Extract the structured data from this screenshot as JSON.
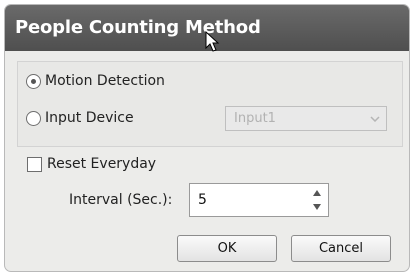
{
  "window": {
    "title": "People Counting Method"
  },
  "method_group": {
    "options": [
      {
        "label": "Motion Detection",
        "checked": true
      },
      {
        "label": "Input Device",
        "checked": false
      }
    ],
    "input_device_select": {
      "value": "Input1",
      "enabled": false
    }
  },
  "reset_everyday": {
    "label": "Reset Everyday",
    "checked": false
  },
  "interval": {
    "label": "Interval (Sec.):",
    "value": "5"
  },
  "buttons": {
    "ok_label": "OK",
    "cancel_label": "Cancel"
  },
  "icons": {
    "cursor": "mouse-pointer-icon",
    "select_arrow": "chevron-down-icon",
    "spin_up": "triangle-up-icon",
    "spin_down": "triangle-down-icon"
  }
}
